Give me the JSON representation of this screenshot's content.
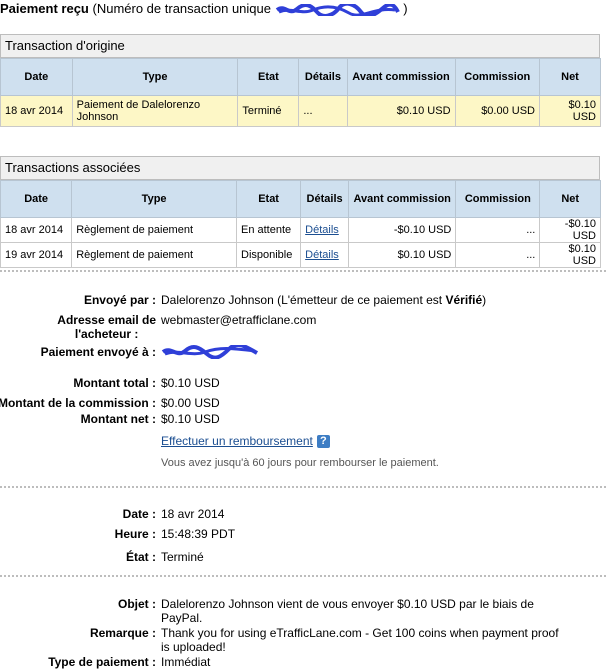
{
  "header": {
    "title": "Paiement reçu",
    "subtitle": "(Numéro de transaction unique"
  },
  "origin": {
    "title": "Transaction d'origine",
    "columns": [
      "Date",
      "Type",
      "Etat",
      "Détails",
      "Avant commission",
      "Commission",
      "Net"
    ],
    "row": {
      "date": "18 avr 2014",
      "type": "Paiement de Dalelorenzo Johnson",
      "etat": "Terminé",
      "details": "...",
      "avant": "$0.10 USD",
      "commission": "$0.00 USD",
      "net": "$0.10 USD"
    }
  },
  "related": {
    "title": "Transactions associées",
    "columns": [
      "Date",
      "Type",
      "Etat",
      "Détails",
      "Avant commission",
      "Commission",
      "Net"
    ],
    "rows": [
      {
        "date": "18 avr 2014",
        "type": "Règlement de paiement",
        "etat": "En attente",
        "details": "Détails",
        "avant": "-$0.10 USD",
        "commission": "...",
        "net": "-$0.10 USD"
      },
      {
        "date": "19 avr 2014",
        "type": "Règlement de paiement",
        "etat": "Disponible",
        "details": "Détails",
        "avant": "$0.10 USD",
        "commission": "...",
        "net": "$0.10 USD"
      }
    ]
  },
  "sender": {
    "sent_by_label": "Envoyé par :",
    "sent_by_name": "Dalelorenzo Johnson",
    "sent_by_note_prefix": "(L'émetteur de ce paiement est",
    "sent_by_note_verified": "Vérifié",
    "sent_by_note_suffix": ")",
    "email_label_line1": "Adresse email de",
    "email_label_line2": "l'acheteur :",
    "email": "webmaster@etrafficlane.com",
    "sent_to_label": "Paiement envoyé à :"
  },
  "amounts": {
    "total_label": "Montant total :",
    "total": "$0.10 USD",
    "commission_label": "Montant de la commission :",
    "commission": "$0.00 USD",
    "net_label": "Montant net :",
    "net": "$0.10 USD",
    "refund_link": "Effectuer un remboursement",
    "help_icon": "?",
    "refund_note": "Vous avez jusqu'à 60 jours pour rembourser le paiement."
  },
  "details": {
    "date_label": "Date :",
    "date": "18 avr 2014",
    "time_label": "Heure :",
    "time": "15:48:39 PDT",
    "state_label": "État :",
    "state": "Terminé"
  },
  "message": {
    "subject_label": "Objet :",
    "subject_line1": "Dalelorenzo Johnson vient de vous envoyer $0.10 USD par le biais de",
    "subject_line2": "PayPal.",
    "remark_label": "Remarque :",
    "remark_line1": "Thank you for using eTrafficLane.com - Get 100 coins when payment proof",
    "remark_line2": "is uploaded!",
    "payment_type_label": "Type de paiement :",
    "payment_type": "Immédiat"
  },
  "colors": {
    "scribble": "#2f3fd8",
    "header_bg": "#cfe0ef",
    "highlight_row": "#fdf7c6",
    "link": "#1b4e91"
  }
}
